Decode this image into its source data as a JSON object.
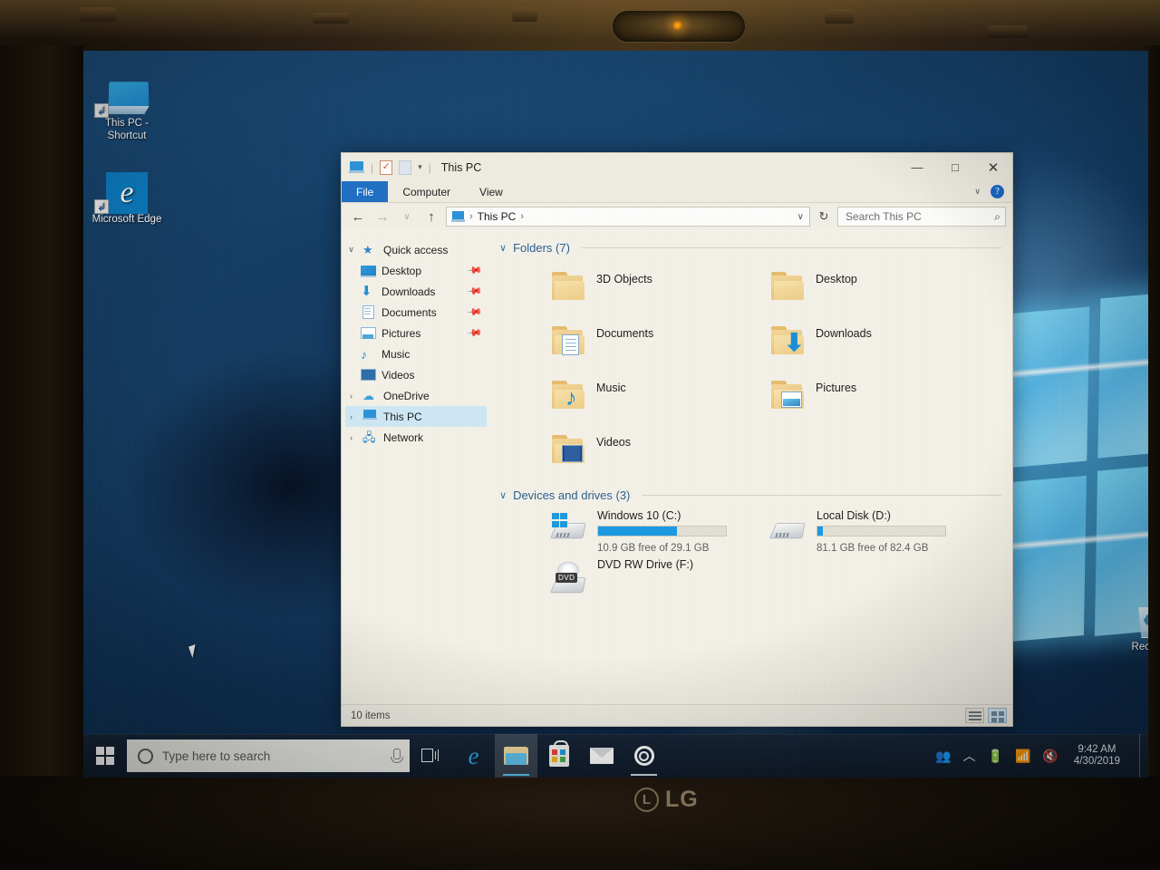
{
  "device": {
    "brand": "LG",
    "webcam_label": "webcam"
  },
  "desktop": {
    "icons": [
      {
        "name": "This PC - Shortcut",
        "icon": "monitor-icon",
        "shortcut": true
      },
      {
        "name": "Microsoft Edge",
        "icon": "edge-icon",
        "shortcut": true
      },
      {
        "name": "Recycle",
        "icon": "recycle-bin-icon",
        "shortcut": false
      }
    ]
  },
  "taskbar": {
    "start_label": "Start",
    "search_placeholder": "Type here to search",
    "items": [
      {
        "name": "task-view",
        "label": "Task View"
      },
      {
        "name": "edge",
        "label": "Microsoft Edge"
      },
      {
        "name": "file-explorer",
        "label": "File Explorer",
        "active": true
      },
      {
        "name": "store",
        "label": "Microsoft Store"
      },
      {
        "name": "mail",
        "label": "Mail"
      },
      {
        "name": "settings",
        "label": "Settings"
      }
    ],
    "tray": {
      "people_icon": "people-icon",
      "chevron_icon": "show-hidden-icons-icon",
      "battery_icon": "battery-icon",
      "network_icon": "wifi-icon",
      "volume_icon": "volume-muted-icon",
      "time": "9:42 AM",
      "date": "4/30/2019"
    }
  },
  "explorer": {
    "title": "This PC",
    "quick_access_toolbar": {
      "properties_label": "Properties",
      "new_folder_label": "New folder",
      "customize_label": "Customize Quick Access Toolbar"
    },
    "window_controls": {
      "minimize": "—",
      "maximize": "□",
      "close": "✕"
    },
    "ribbon": {
      "tabs": [
        "File",
        "Computer",
        "View"
      ],
      "collapse_label": "∨",
      "help_label": "?"
    },
    "nav": {
      "back": "←",
      "forward": "→",
      "recent": "∨",
      "up": "↑"
    },
    "address": {
      "crumbs": [
        "This PC"
      ],
      "separator": "›",
      "dropdown": "∨",
      "refresh": "↻"
    },
    "search": {
      "placeholder": "Search This PC",
      "icon": "search-icon"
    },
    "sidebar": [
      {
        "label": "Quick access",
        "icon": "star-icon",
        "chevron": "∨",
        "level": 0,
        "pinned": false,
        "selected": false
      },
      {
        "label": "Desktop",
        "icon": "desktop-icon",
        "chevron": "",
        "level": 1,
        "pinned": true,
        "selected": false
      },
      {
        "label": "Downloads",
        "icon": "downloads-icon",
        "chevron": "",
        "level": 1,
        "pinned": true,
        "selected": false
      },
      {
        "label": "Documents",
        "icon": "documents-icon",
        "chevron": "",
        "level": 1,
        "pinned": true,
        "selected": false
      },
      {
        "label": "Pictures",
        "icon": "pictures-icon",
        "chevron": "",
        "level": 1,
        "pinned": true,
        "selected": false
      },
      {
        "label": "Music",
        "icon": "music-icon",
        "chevron": "",
        "level": 1,
        "pinned": false,
        "selected": false
      },
      {
        "label": "Videos",
        "icon": "videos-icon",
        "chevron": "",
        "level": 1,
        "pinned": false,
        "selected": false
      },
      {
        "label": "OneDrive",
        "icon": "onedrive-icon",
        "chevron": "›",
        "level": 0,
        "pinned": false,
        "selected": false
      },
      {
        "label": "This PC",
        "icon": "this-pc-icon",
        "chevron": "›",
        "level": 0,
        "pinned": false,
        "selected": true
      },
      {
        "label": "Network",
        "icon": "network-icon",
        "chevron": "›",
        "level": 0,
        "pinned": false,
        "selected": false
      }
    ],
    "groups": {
      "folders": {
        "header": "Folders (7)",
        "chevron": "∨",
        "items": [
          {
            "name": "3D Objects",
            "icon": "3d-objects-folder-icon"
          },
          {
            "name": "Desktop",
            "icon": "desktop-folder-icon"
          },
          {
            "name": "Documents",
            "icon": "documents-folder-icon"
          },
          {
            "name": "Downloads",
            "icon": "downloads-folder-icon"
          },
          {
            "name": "Music",
            "icon": "music-folder-icon"
          },
          {
            "name": "Pictures",
            "icon": "pictures-folder-icon"
          },
          {
            "name": "Videos",
            "icon": "videos-folder-icon"
          }
        ]
      },
      "devices": {
        "header": "Devices and drives (3)",
        "chevron": "∨",
        "items": [
          {
            "name": "Windows 10 (C:)",
            "icon": "windows-drive-icon",
            "free_text": "10.9 GB free of 29.1 GB",
            "used_percent": 62,
            "bar_color": "#1b9ae3",
            "has_bar": true
          },
          {
            "name": "Local Disk (D:)",
            "icon": "hard-drive-icon",
            "free_text": "81.1 GB free of 82.4 GB",
            "used_percent": 4,
            "bar_color": "#1b9ae3",
            "has_bar": true
          },
          {
            "name": "DVD RW Drive (F:)",
            "icon": "dvd-drive-icon",
            "free_text": "",
            "used_percent": 0,
            "bar_color": "#1b9ae3",
            "has_bar": false
          }
        ]
      }
    },
    "status": {
      "item_count": "10 items",
      "view_details_label": "Details view",
      "view_large_label": "Large icons view"
    }
  },
  "colors": {
    "accent": "#1e6fc4",
    "selection": "#cfe8f5",
    "window_bg": "#f4f1e8",
    "drive_bar": "#1b9ae3",
    "taskbar": "#16263a"
  }
}
